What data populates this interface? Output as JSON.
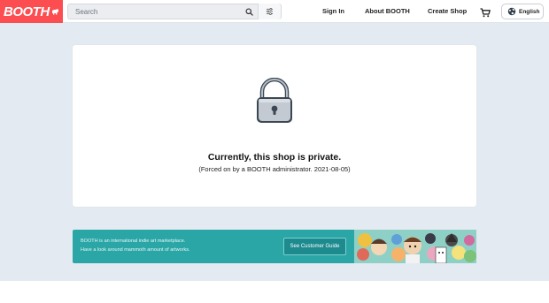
{
  "header": {
    "logo_text": "BOOTH",
    "search_placeholder": "Search",
    "sign_in": "Sign In",
    "about": "About BOOTH",
    "create_shop": "Create Shop",
    "language": "English"
  },
  "notice": {
    "title": "Currently, this shop is private.",
    "subtitle": "(Forced on by a BOOTH administrator. 2021-08-05)"
  },
  "banner": {
    "line1": "BOOTH is an international indie art marketplace.",
    "line2": "Have a look around mammoth amount of artworks.",
    "button_label": "See Customer Guide"
  },
  "colors": {
    "brand": "#fc4d50",
    "background": "#e4eaf1",
    "banner": "#2aa6a6"
  },
  "icons": [
    "search-icon",
    "filter-icon",
    "cart-icon",
    "globe-icon",
    "lock-icon"
  ]
}
